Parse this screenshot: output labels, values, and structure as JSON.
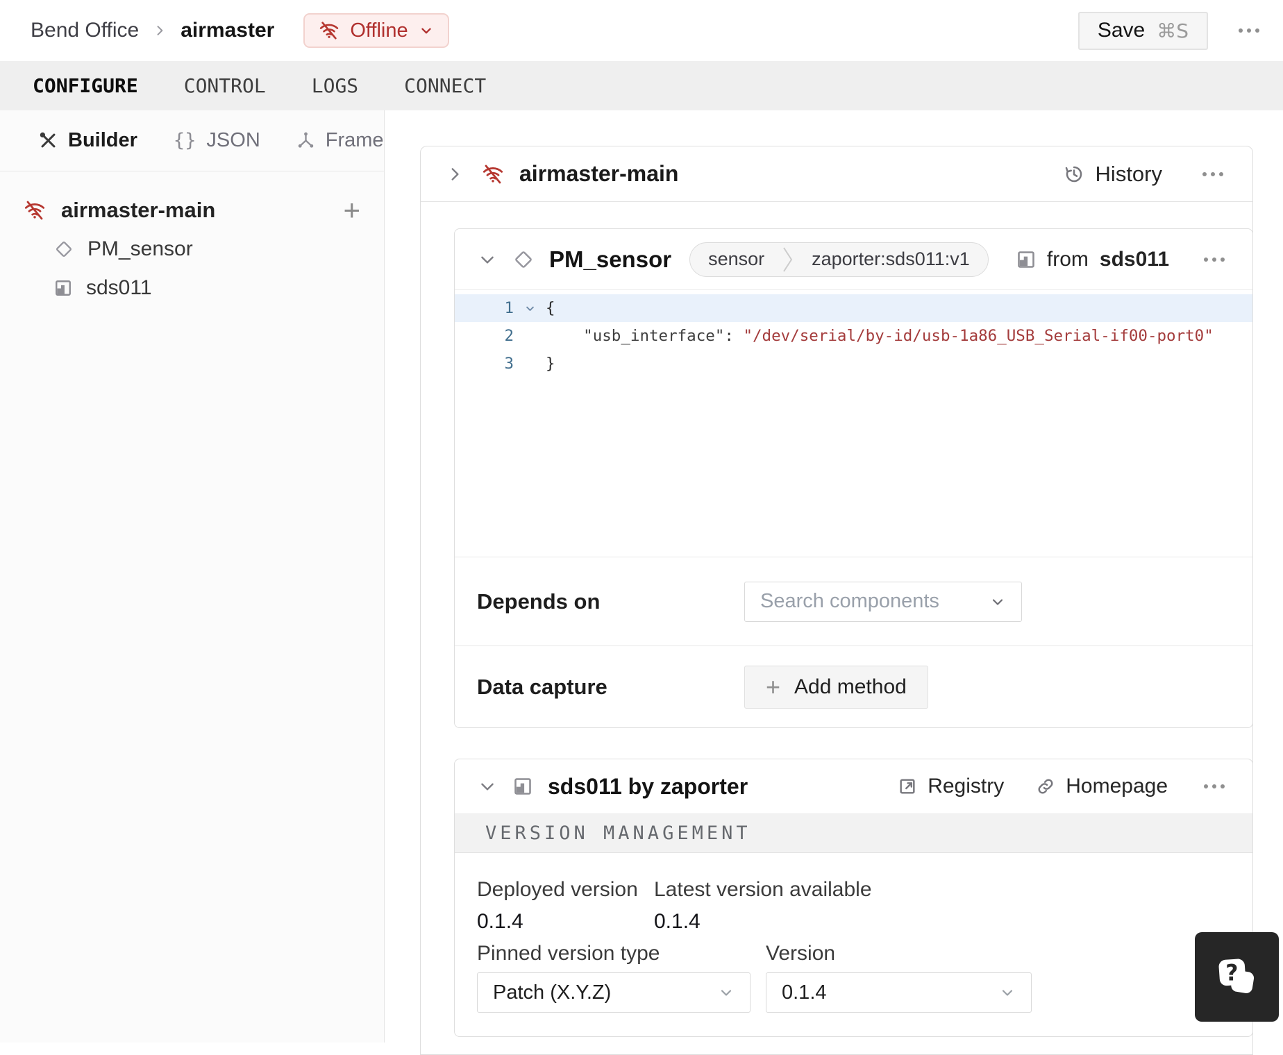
{
  "colors": {
    "offline_red": "#b0302e",
    "offline_badge_bg": "#fdefee",
    "offline_badge_border": "#f2d2ce",
    "code_string_red": "#a43c3c",
    "active_code_line_bg": "#e9f1fb",
    "line_number_blue": "#43708f",
    "tabbar_bg": "#efefef",
    "card_border": "#dedede",
    "help_button_bg": "#262626"
  },
  "topbar": {
    "breadcrumb": {
      "org": "Bend Office",
      "machine": "airmaster"
    },
    "status": {
      "label": "Offline",
      "icon": "wifi-off-icon"
    },
    "save": {
      "label": "Save",
      "shortcut": "⌘S"
    }
  },
  "tabs": [
    {
      "label": "CONFIGURE",
      "active": true
    },
    {
      "label": "CONTROL",
      "active": false
    },
    {
      "label": "LOGS",
      "active": false
    },
    {
      "label": "CONNECT",
      "active": false
    }
  ],
  "sidebar": {
    "modes": [
      {
        "label": "Builder",
        "icon": "tools-icon",
        "active": true
      },
      {
        "label": "JSON",
        "icon": "braces-icon",
        "active": false
      },
      {
        "label": "Frame",
        "icon": "frame-axes-icon",
        "active": false
      }
    ],
    "tree": {
      "root": {
        "label": "airmaster-main",
        "icon": "wifi-off-icon"
      },
      "children": [
        {
          "label": "PM_sensor",
          "icon": "component-diamond-icon"
        },
        {
          "label": "sds011",
          "icon": "module-icon"
        }
      ]
    },
    "braces_glyph": "{}"
  },
  "part": {
    "title": "airmaster-main",
    "history_label": "History"
  },
  "component": {
    "title": "PM_sensor",
    "type_badge": "sensor",
    "model_badge": "zaporter:sds011:v1",
    "from_label": "from",
    "from_module": "sds011",
    "code": {
      "line_numbers": [
        "1",
        "2",
        "3"
      ],
      "line1": "{",
      "line2_key": "\"usb_interface\"",
      "line2_colon": ": ",
      "line2_value": "\"/dev/serial/by-id/usb-1a86_USB_Serial-if00-port0\"",
      "line3": "}"
    },
    "depends_on": {
      "label": "Depends on",
      "placeholder": "Search components"
    },
    "data_capture": {
      "label": "Data capture",
      "add_button": "Add method"
    }
  },
  "module": {
    "title": "sds011 by zaporter",
    "registry_label": "Registry",
    "homepage_label": "Homepage",
    "section_title": "VERSION MANAGEMENT",
    "deployed": {
      "label": "Deployed version",
      "value": "0.1.4"
    },
    "latest": {
      "label": "Latest version available",
      "value": "0.1.4"
    },
    "pinned": {
      "label": "Pinned version type",
      "value": "Patch (X.Y.Z)"
    },
    "version": {
      "label": "Version",
      "value": "0.1.4"
    }
  }
}
